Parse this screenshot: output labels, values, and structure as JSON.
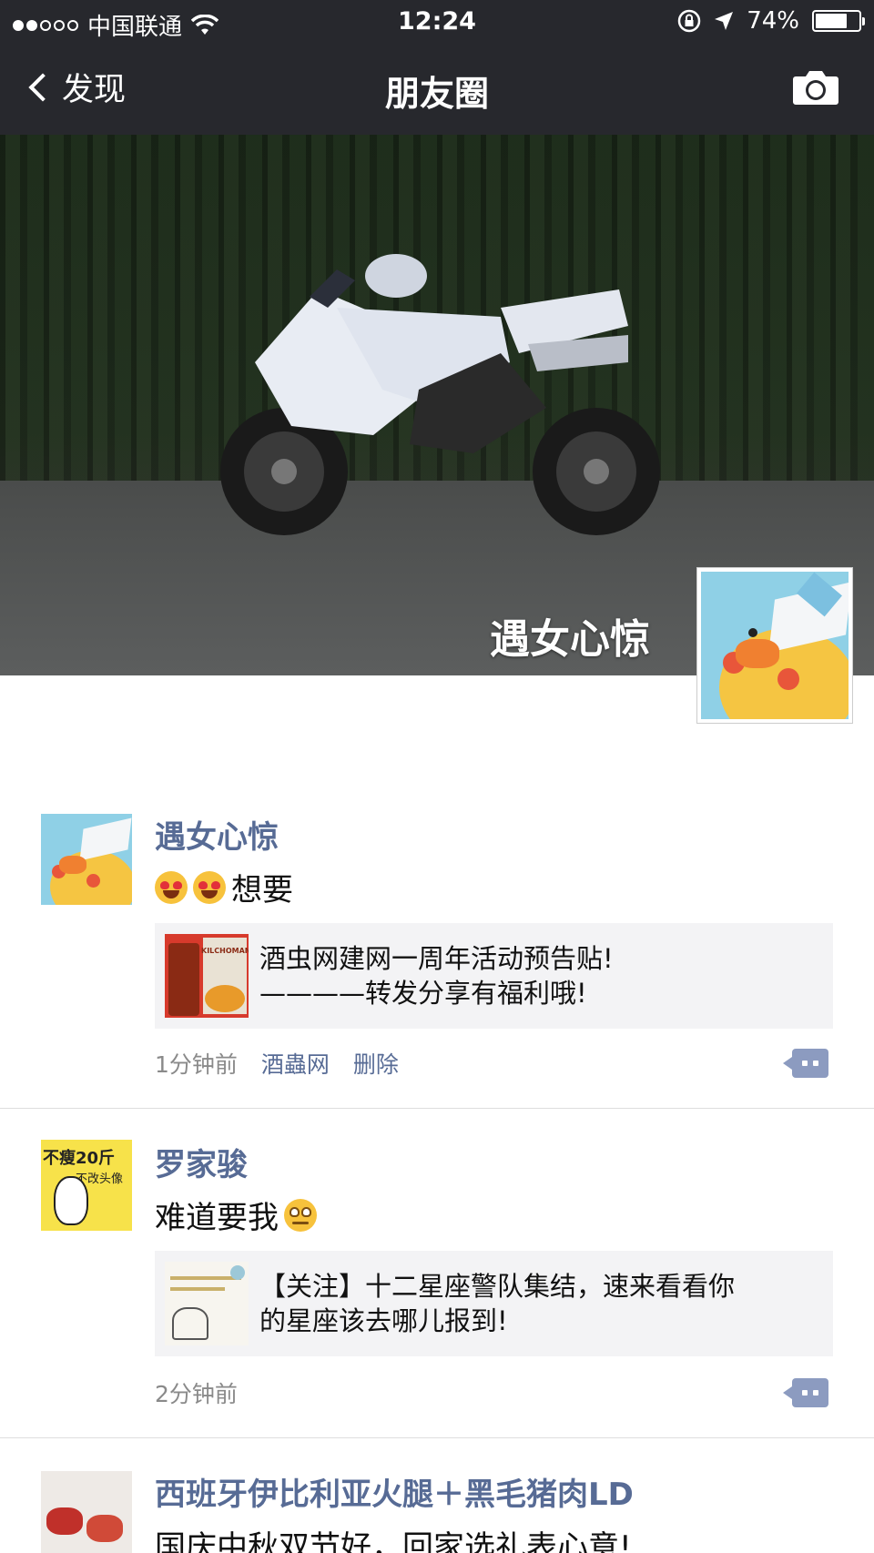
{
  "status_bar": {
    "carrier": "中国联通",
    "time": "12:24",
    "battery": "74%",
    "battery_level": 0.74,
    "signal_icon": "signal-dots-icon",
    "wifi_icon": "wifi-icon",
    "lock_icon": "rotation-lock-icon",
    "location_icon": "location-arrow-icon"
  },
  "nav": {
    "back_label": "发现",
    "title": "朋友圈",
    "camera_icon": "camera-icon"
  },
  "cover": {
    "owner_name": "遇女心惊"
  },
  "colors": {
    "nav_bg": "#27282d",
    "name_link": "#576b95",
    "share_bg": "#f3f3f5",
    "meta_gray": "#8a8a8a"
  },
  "posts": [
    {
      "name": "遇女心惊",
      "text": "想要",
      "emoji": [
        "heart-eyes-emoji",
        "heart-eyes-emoji"
      ],
      "share_line1": "酒虫网建网一周年活动预告贴!",
      "share_line2": "————转发分享有福利哦!",
      "thumb_text": "KILCHOMAN",
      "time": "1分钟前",
      "source": "酒蟲网",
      "delete": "删除"
    },
    {
      "name": "罗家骏",
      "text": "难道要我",
      "emoji": [
        "eye-roll-emoji"
      ],
      "share_line1": "【关注】十二星座警队集结，速来看看你",
      "share_line2": "的星座该去哪儿报到!",
      "avatar_text1": "不瘦20斤",
      "avatar_text2": "不改头像",
      "time": "2分钟前"
    },
    {
      "name": "西班牙伊比利亚火腿＋黑毛猪肉LD",
      "text": "国庆中秋双节好，回家选礼表心意!"
    }
  ]
}
